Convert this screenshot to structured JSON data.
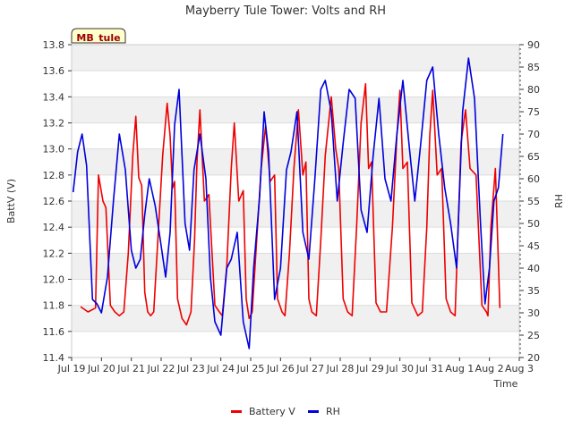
{
  "chart_data": {
    "type": "line",
    "title": "Mayberry Tule Tower: Volts and RH",
    "xlabel": "Time",
    "ylabel_left": "BattV (V)",
    "ylabel_right": "RH",
    "station_label": "MB_tule",
    "x_ticks": [
      "Jul 19",
      "Jul 20",
      "Jul 21",
      "Jul 22",
      "Jul 23",
      "Jul 24",
      "Jul 25",
      "Jul 26",
      "Jul 27",
      "Jul 28",
      "Jul 29",
      "Jul 30",
      "Jul 31",
      "Aug 1",
      "Aug 2",
      "Aug 3"
    ],
    "y_left": {
      "min": 11.4,
      "max": 13.8,
      "ticks": [
        "11.4",
        "11.6",
        "11.8",
        "12.0",
        "12.2",
        "12.4",
        "12.6",
        "12.8",
        "13.0",
        "13.2",
        "13.4",
        "13.6",
        "13.8"
      ]
    },
    "y_right": {
      "min": 20,
      "max": 90,
      "ticks": [
        "20",
        "25",
        "30",
        "35",
        "40",
        "45",
        "50",
        "55",
        "60",
        "65",
        "70",
        "75",
        "80",
        "85",
        "90"
      ]
    },
    "grid": true,
    "legend_position": "bottom-center",
    "colors": {
      "battery": "#ee0000",
      "rh": "#0000dd",
      "band": "#f0f0f0",
      "label_bg": "#ffffcc",
      "label_text": "#990000"
    },
    "series": [
      {
        "name": "Battery V",
        "axis": "left",
        "x": [
          0.3,
          0.55,
          0.8,
          0.9,
          1.05,
          1.15,
          1.3,
          1.45,
          1.6,
          1.75,
          1.9,
          2.05,
          2.15,
          2.25,
          2.35,
          2.45,
          2.55,
          2.65,
          2.75,
          2.9,
          3.05,
          3.2,
          3.3,
          3.38,
          3.45,
          3.55,
          3.7,
          3.85,
          4.0,
          4.12,
          4.2,
          4.3,
          4.45,
          4.6,
          4.8,
          4.95,
          5.05,
          5.2,
          5.35,
          5.45,
          5.6,
          5.75,
          5.85,
          5.95,
          6.05,
          6.2,
          6.35,
          6.5,
          6.65,
          6.8,
          6.9,
          7.05,
          7.15,
          7.3,
          7.45,
          7.6,
          7.75,
          7.85,
          7.95,
          8.05,
          8.2,
          8.35,
          8.5,
          8.7,
          8.85,
          8.95,
          9.1,
          9.25,
          9.4,
          9.55,
          9.7,
          9.85,
          9.95,
          10.05,
          10.2,
          10.35,
          10.55,
          10.75,
          10.9,
          11.0,
          11.1,
          11.25,
          11.4,
          11.6,
          11.75,
          11.9,
          12.0,
          12.1,
          12.25,
          12.4,
          12.55,
          12.7,
          12.85,
          12.95,
          13.05,
          13.2,
          13.35,
          13.55,
          13.75,
          13.9,
          13.95,
          14.05,
          14.2,
          14.35
        ],
        "values": [
          11.79,
          11.75,
          11.78,
          12.8,
          12.6,
          12.55,
          11.8,
          11.75,
          11.72,
          11.75,
          12.2,
          12.95,
          13.25,
          12.78,
          12.72,
          11.9,
          11.75,
          11.72,
          11.75,
          12.35,
          12.95,
          13.35,
          13.1,
          12.7,
          12.75,
          11.85,
          11.7,
          11.65,
          11.75,
          12.3,
          12.9,
          13.3,
          12.6,
          12.65,
          11.8,
          11.75,
          11.72,
          12.1,
          12.85,
          13.2,
          12.6,
          12.68,
          11.85,
          11.7,
          11.75,
          12.3,
          12.85,
          13.18,
          12.75,
          12.8,
          11.85,
          11.75,
          11.72,
          12.2,
          12.85,
          13.3,
          12.8,
          12.9,
          11.85,
          11.75,
          11.72,
          12.3,
          12.95,
          13.4,
          13.0,
          12.85,
          11.85,
          11.75,
          11.72,
          12.4,
          13.2,
          13.5,
          12.85,
          12.9,
          11.82,
          11.75,
          11.75,
          12.4,
          13.1,
          13.45,
          12.85,
          12.9,
          11.82,
          11.72,
          11.75,
          12.4,
          13.1,
          13.45,
          12.8,
          12.85,
          11.85,
          11.75,
          11.72,
          12.4,
          13.05,
          13.3,
          12.85,
          12.8,
          11.8,
          11.75,
          11.72,
          12.4,
          12.85,
          11.78
        ]
      },
      {
        "name": "RH",
        "axis": "right",
        "x": [
          0.05,
          0.2,
          0.35,
          0.5,
          0.7,
          0.85,
          1.0,
          1.2,
          1.4,
          1.6,
          1.8,
          2.0,
          2.15,
          2.3,
          2.45,
          2.6,
          2.8,
          3.0,
          3.15,
          3.3,
          3.45,
          3.6,
          3.8,
          3.95,
          4.1,
          4.3,
          4.5,
          4.65,
          4.8,
          5.0,
          5.2,
          5.35,
          5.55,
          5.75,
          5.95,
          6.1,
          6.3,
          6.45,
          6.6,
          6.8,
          7.0,
          7.2,
          7.35,
          7.55,
          7.75,
          7.95,
          8.15,
          8.35,
          8.5,
          8.7,
          8.9,
          9.1,
          9.3,
          9.5,
          9.7,
          9.9,
          10.1,
          10.3,
          10.5,
          10.7,
          10.9,
          11.1,
          11.3,
          11.5,
          11.7,
          11.9,
          12.1,
          12.3,
          12.5,
          12.7,
          12.9,
          13.1,
          13.3,
          13.5,
          13.7,
          13.85,
          14.0,
          14.15,
          14.3,
          14.45
        ],
        "values": [
          57,
          66,
          70,
          63,
          33,
          32,
          30,
          38,
          55,
          70,
          62,
          44,
          40,
          42,
          52,
          60,
          54,
          45,
          38,
          48,
          72,
          80,
          50,
          44,
          62,
          70,
          60,
          38,
          28,
          25,
          40,
          42,
          48,
          28,
          22,
          40,
          56,
          75,
          66,
          33,
          40,
          62,
          66,
          75,
          48,
          42,
          60,
          80,
          82,
          75,
          55,
          68,
          80,
          78,
          53,
          48,
          65,
          78,
          60,
          55,
          70,
          82,
          68,
          55,
          68,
          82,
          85,
          70,
          58,
          50,
          40,
          75,
          87,
          78,
          50,
          32,
          40,
          55,
          58,
          70
        ]
      }
    ]
  }
}
